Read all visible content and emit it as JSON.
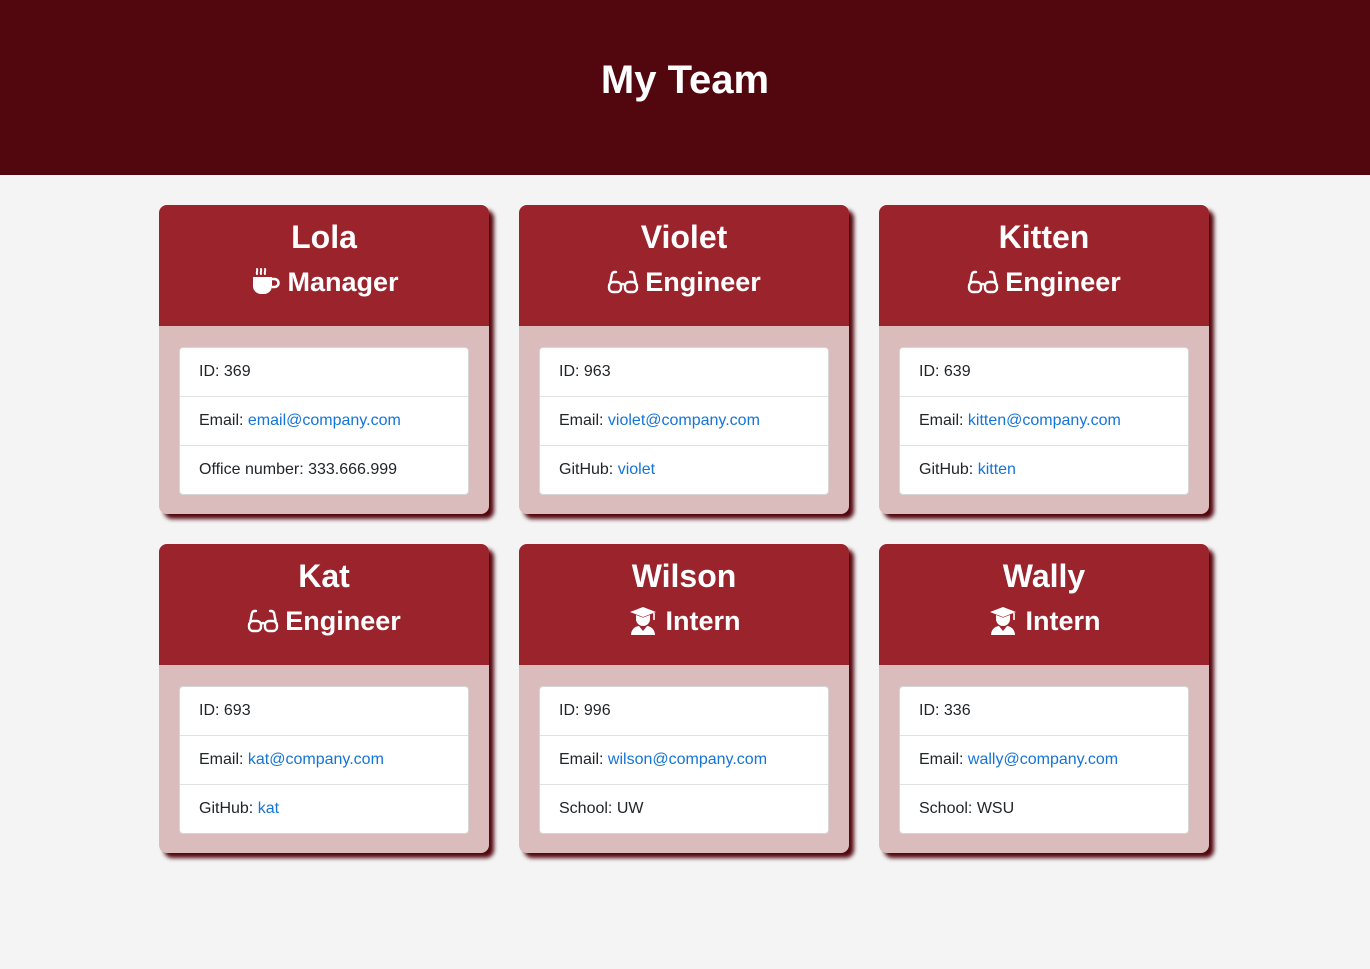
{
  "page": {
    "title": "My Team"
  },
  "colors": {
    "header": "#52070f",
    "card_head": "#9b232c",
    "card_body": "#dbbcbd",
    "link": "#1474d9"
  },
  "cards": [
    {
      "name": "Lola",
      "role": "Manager",
      "icon": "coffee-icon",
      "id_label": "ID: ",
      "id": "369",
      "email_label": "Email: ",
      "email": "email@company.com",
      "extra_label": "Office number: ",
      "extra": "333.666.999"
    },
    {
      "name": "Violet",
      "role": "Engineer",
      "icon": "glasses-icon",
      "id_label": "ID: ",
      "id": "963",
      "email_label": "Email: ",
      "email": "violet@company.com",
      "extra_label": "GitHub: ",
      "extra": "violet"
    },
    {
      "name": "Kitten",
      "role": "Engineer",
      "icon": "glasses-icon",
      "id_label": "ID: ",
      "id": "639",
      "email_label": "Email: ",
      "email": "kitten@company.com",
      "extra_label": "GitHub: ",
      "extra": "kitten"
    },
    {
      "name": "Kat",
      "role": "Engineer",
      "icon": "glasses-icon",
      "id_label": "ID: ",
      "id": "693",
      "email_label": "Email: ",
      "email": "kat@company.com",
      "extra_label": "GitHub: ",
      "extra": "kat"
    },
    {
      "name": "Wilson",
      "role": "Intern",
      "icon": "graduate-icon",
      "id_label": "ID: ",
      "id": "996",
      "email_label": "Email: ",
      "email": "wilson@company.com",
      "extra_label": "School: ",
      "extra": "UW"
    },
    {
      "name": "Wally",
      "role": "Intern",
      "icon": "graduate-icon",
      "id_label": "ID: ",
      "id": "336",
      "email_label": "Email: ",
      "email": "wally@company.com",
      "extra_label": "School: ",
      "extra": "WSU"
    }
  ]
}
